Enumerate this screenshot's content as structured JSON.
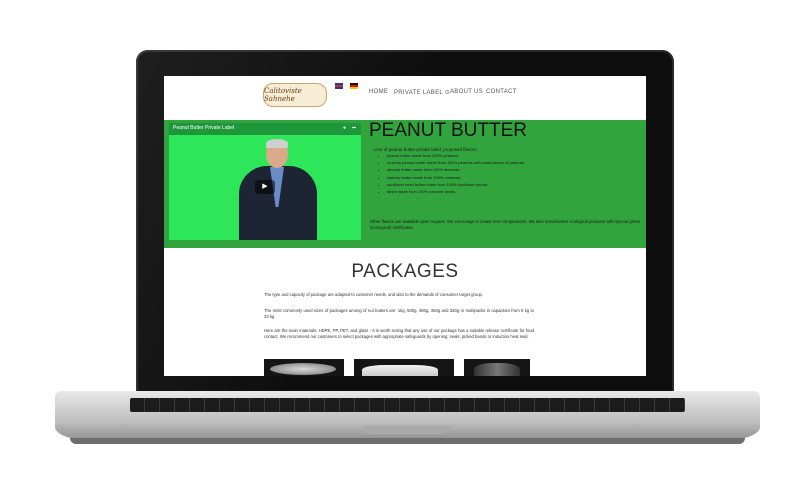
{
  "site": {
    "logo_text": "Calitoviste Sahnehe",
    "flags": [
      "uk-flag-icon",
      "de-flag-icon"
    ],
    "nav": [
      {
        "label": "HOME"
      },
      {
        "label": "PRIVATE LABEL",
        "has_dropdown": true,
        "icon": "chevron-down-circle-icon"
      },
      {
        "label": "ABOUT US"
      },
      {
        "label": "CONTACT"
      }
    ]
  },
  "hero": {
    "background_color": "#31a43e",
    "video": {
      "title": "Peanut Butter Private Label",
      "icons": [
        "clock-icon",
        "share-icon",
        "play-icon"
      ]
    },
    "title": "PEANUT BUTTER",
    "lead": "Line of peanut butter private label, proposed flavors:",
    "flavors": [
      "peanut butter made from 100% peanuts;",
      "crunchy peanut butter made from 100% peanuts with small pieces of peanuts;",
      "almond butter made from 100% almonds;",
      "cashew butter made from 100% cashews;",
      "sunflower seed butter made from 100% sunflower seeds;",
      "tahini made from 100% sesame seeds."
    ],
    "note": "Other flavors are available upon request. We encourage to create new compositions. We also manufacture ecological products with special green (ecological) certificates."
  },
  "packages": {
    "title": "PACKAGES",
    "paragraphs": [
      "The type and capacity of package are adapted to customer needs, and also to the demands of consumer target group.",
      "The most commonly used sizes of packages among of nut butters are: 1kg, 500g, 480g, 350g and 330g or multipacks in capacities from 5 kg to 33 kg.",
      "Here are the main materials: HDPE, PP, PET, and glass - It is worth noting that any use of our package has a suitable release certificate for food contact. We recommend our customers to select packages with appropriate safeguards by opening: seals, picked bands or induction heat seal."
    ]
  }
}
